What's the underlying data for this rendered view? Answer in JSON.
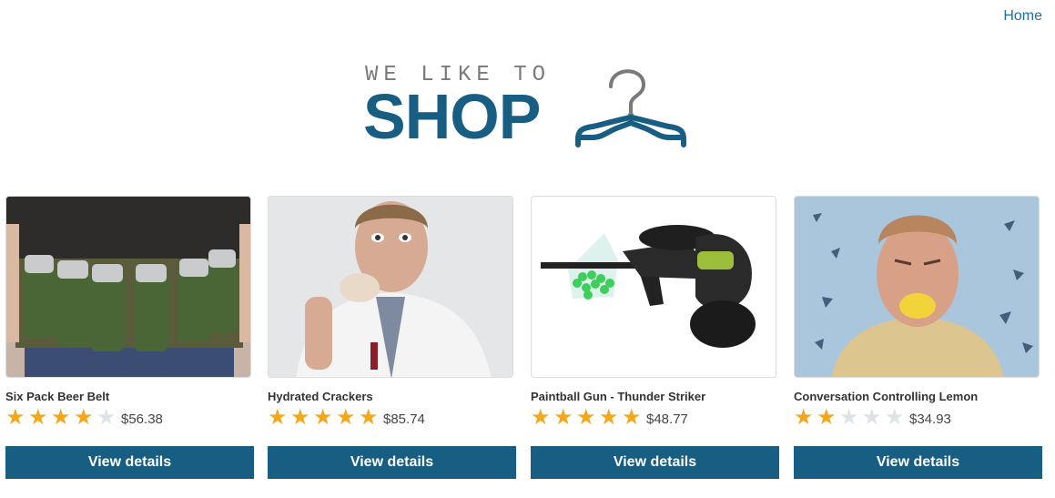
{
  "nav": {
    "home_label": "Home"
  },
  "logo": {
    "small_text": "WE LIKE TO",
    "big_text": "SHOP",
    "icon": "hanger-icon"
  },
  "colors": {
    "brand": "#175e82",
    "link": "#1e6ea7",
    "star_on": "#f4a819",
    "star_off": "#dde3e6"
  },
  "products": [
    {
      "name": "Six Pack Beer Belt",
      "rating": 4,
      "rating_max": 5,
      "price": "$56.38",
      "button_label": "View details",
      "image": "beer-belt-photo"
    },
    {
      "name": "Hydrated Crackers",
      "rating": 5,
      "rating_max": 5,
      "price": "$85.74",
      "button_label": "View details",
      "image": "man-eating-cracker-photo"
    },
    {
      "name": "Paintball Gun - Thunder Striker",
      "rating": 5,
      "rating_max": 5,
      "price": "$48.77",
      "button_label": "View details",
      "image": "paintball-gun-photo"
    },
    {
      "name": "Conversation Controlling Lemon",
      "rating": 2,
      "rating_max": 5,
      "price": "$34.93",
      "button_label": "View details",
      "image": "man-with-lemon-photo"
    }
  ]
}
